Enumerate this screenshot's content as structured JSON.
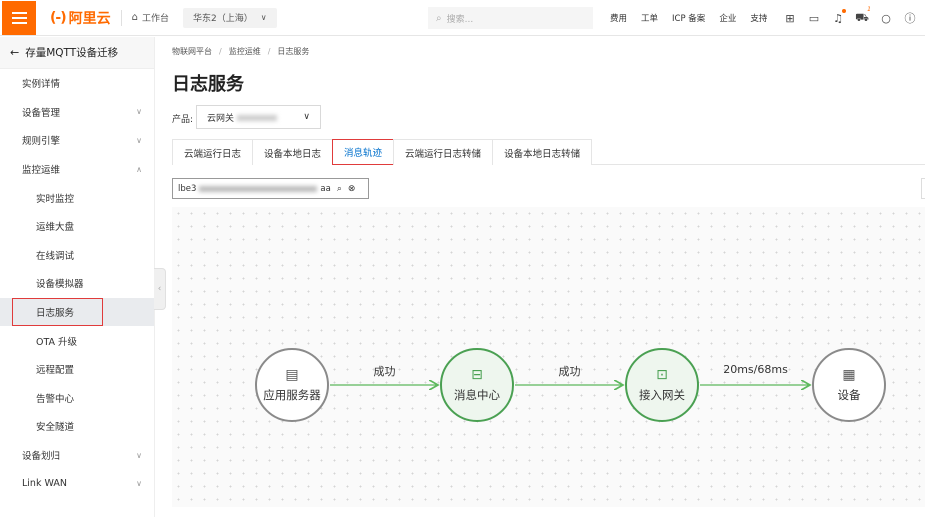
{
  "topbar": {
    "brand": "阿里云",
    "brand_mark": "(-)",
    "workbench": "工作台",
    "region": "华东2（上海）",
    "search_placeholder": "搜索...",
    "links": [
      "费用",
      "工单",
      "ICP 备案",
      "企业",
      "支持"
    ],
    "icons": [
      "terminal-icon",
      "screen-icon",
      "bell-icon",
      "cart-icon",
      "lightbulb-icon",
      "help-icon"
    ],
    "bell_badge": "●",
    "cart_badge": "1"
  },
  "sidebar": {
    "back_label": "存量MQTT设备迁移",
    "items": [
      {
        "label": "实例详情",
        "sub": false,
        "chevron": ""
      },
      {
        "label": "设备管理",
        "sub": false,
        "chevron": "down"
      },
      {
        "label": "规则引擎",
        "sub": false,
        "chevron": "down"
      },
      {
        "label": "监控运维",
        "sub": false,
        "chevron": "up"
      },
      {
        "label": "实时监控",
        "sub": true,
        "chevron": ""
      },
      {
        "label": "运维大盘",
        "sub": true,
        "chevron": ""
      },
      {
        "label": "在线调试",
        "sub": true,
        "chevron": ""
      },
      {
        "label": "设备模拟器",
        "sub": true,
        "chevron": ""
      },
      {
        "label": "日志服务",
        "sub": true,
        "chevron": "",
        "active": true
      },
      {
        "label": "OTA 升级",
        "sub": true,
        "chevron": ""
      },
      {
        "label": "远程配置",
        "sub": true,
        "chevron": ""
      },
      {
        "label": "告警中心",
        "sub": true,
        "chevron": ""
      },
      {
        "label": "安全隧道",
        "sub": true,
        "chevron": ""
      },
      {
        "label": "设备划归",
        "sub": false,
        "chevron": "down"
      },
      {
        "label": "Link WAN",
        "sub": false,
        "chevron": "down"
      }
    ]
  },
  "main": {
    "breadcrumb": [
      "物联网平台",
      "监控运维",
      "日志服务"
    ],
    "title": "日志服务",
    "product_label": "产品:",
    "product_value": "云网关",
    "tabs": [
      {
        "label": "云端运行日志",
        "active": false
      },
      {
        "label": "设备本地日志",
        "active": false
      },
      {
        "label": "消息轨迹",
        "active": true
      },
      {
        "label": "云端运行日志转储",
        "active": false
      },
      {
        "label": "设备本地日志转储",
        "active": false
      }
    ],
    "query_prefix": "lbe3",
    "query_suffix": "aa"
  },
  "flow": {
    "nodes": [
      {
        "label": "应用服务器",
        "icon": "server-icon",
        "glyph": "▤",
        "state": "grey"
      },
      {
        "label": "消息中心",
        "icon": "message-center-icon",
        "glyph": "⊟",
        "state": "green"
      },
      {
        "label": "接入网关",
        "icon": "gateway-icon",
        "glyph": "⊡",
        "state": "green"
      },
      {
        "label": "设备",
        "icon": "device-icon",
        "glyph": "▦",
        "state": "grey"
      }
    ],
    "edges": [
      {
        "label": "成功"
      },
      {
        "label": "成功"
      },
      {
        "label": "20ms/68ms"
      }
    ],
    "edge_color": "#5cb85c"
  }
}
